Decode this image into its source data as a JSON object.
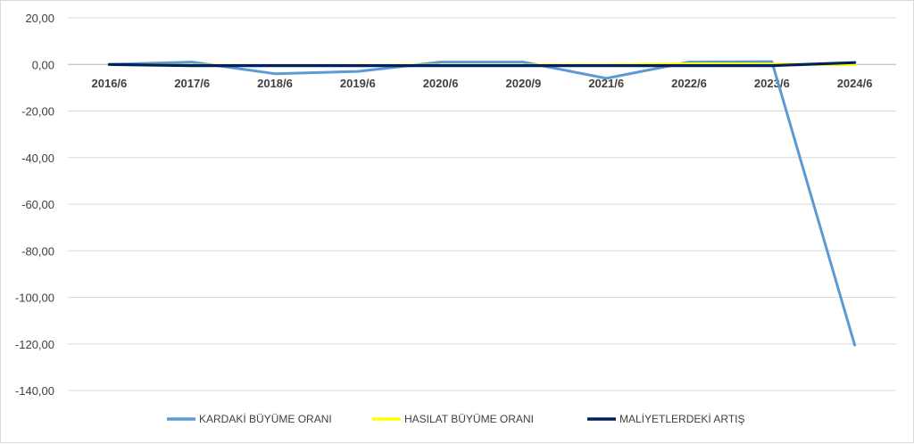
{
  "chart_data": {
    "type": "line",
    "title": "",
    "xlabel": "",
    "ylabel": "",
    "categories": [
      "2016/6",
      "2017/6",
      "2018/6",
      "2019/6",
      "2020/6",
      "2020/9",
      "2021/6",
      "2022/6",
      "2023/6",
      "2024/6"
    ],
    "ylim": [
      -140,
      20
    ],
    "yticks": [
      "20,00",
      "0,00",
      "-20,00",
      "-40,00",
      "-60,00",
      "-80,00",
      "-100,00",
      "-120,00",
      "-140,00"
    ],
    "ytick_values": [
      20,
      0,
      -20,
      -40,
      -60,
      -80,
      -100,
      -120,
      -140
    ],
    "grid": true,
    "legend_position": "bottom",
    "series": [
      {
        "name": "KARDAKİ BÜYÜME ORANI",
        "color": "#5b9bd5",
        "values": [
          0.0,
          1.0,
          -4.0,
          -3.0,
          1.0,
          1.0,
          -6.0,
          1.0,
          1.2,
          -120.5
        ]
      },
      {
        "name": "HASILAT BÜYÜME ORANI",
        "color": "#ffff00",
        "values": [
          0.0,
          -0.3,
          -0.5,
          -0.4,
          -0.3,
          -0.3,
          -0.2,
          0.3,
          0.2,
          -0.2
        ]
      },
      {
        "name": "MALİYETLERDEKİ ARTIŞ",
        "color": "#002060",
        "values": [
          0.0,
          -0.5,
          -0.5,
          -0.5,
          -0.5,
          -0.5,
          -0.5,
          -0.5,
          -0.5,
          0.8
        ]
      }
    ]
  }
}
